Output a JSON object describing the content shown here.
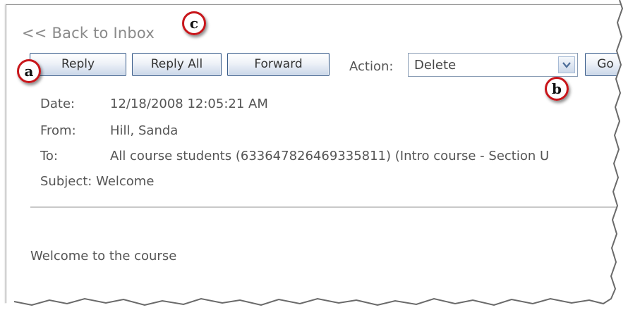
{
  "back_link": "<< Back to Inbox",
  "toolbar": {
    "reply_label": "Reply",
    "reply_all_label": "Reply All",
    "forward_label": "Forward",
    "action_label": "Action:",
    "action_selected": "Delete",
    "go_label": "Go"
  },
  "message": {
    "date_label": "Date:",
    "date_value": "12/18/2008 12:05:21 AM",
    "from_label": "From:",
    "from_value": "Hill, Sanda",
    "to_label": "To:",
    "to_value": "All course students (633647826469335811) (Intro course - Section U",
    "subject_line": "Subject: Welcome",
    "body": "Welcome to the course"
  },
  "callouts": {
    "a": "a",
    "b": "b",
    "c": "c"
  },
  "colors": {
    "callout_ring": "#c8161b",
    "button_border": "#3b5d8a",
    "text": "#555555",
    "link": "#8a8a8a"
  },
  "icons": {
    "dropdown": "chevron-down-icon"
  }
}
